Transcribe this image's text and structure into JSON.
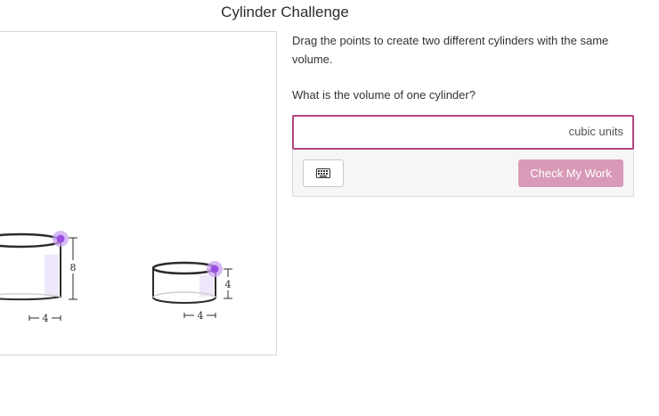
{
  "page": {
    "title": "Cylinder Challenge"
  },
  "instructions": {
    "text": "Drag the points to create two different cylinders with the same volume."
  },
  "question": {
    "text": "What is the volume of one cylinder?"
  },
  "answer": {
    "value": "",
    "placeholder": "",
    "units": "cubic units"
  },
  "toolbar": {
    "keyboard_icon": "keyboard-icon",
    "check_label": "Check My Work"
  },
  "colors": {
    "accent": "#b2457e",
    "check_button": "#d89ab7",
    "handle": "#9b4fe0",
    "handle_halo": "#c9a3f2",
    "shade": "#efe7fb"
  },
  "cylinders": [
    {
      "radius_label": "4",
      "height_label": "8"
    },
    {
      "radius_label": "4",
      "height_label": "4"
    }
  ]
}
